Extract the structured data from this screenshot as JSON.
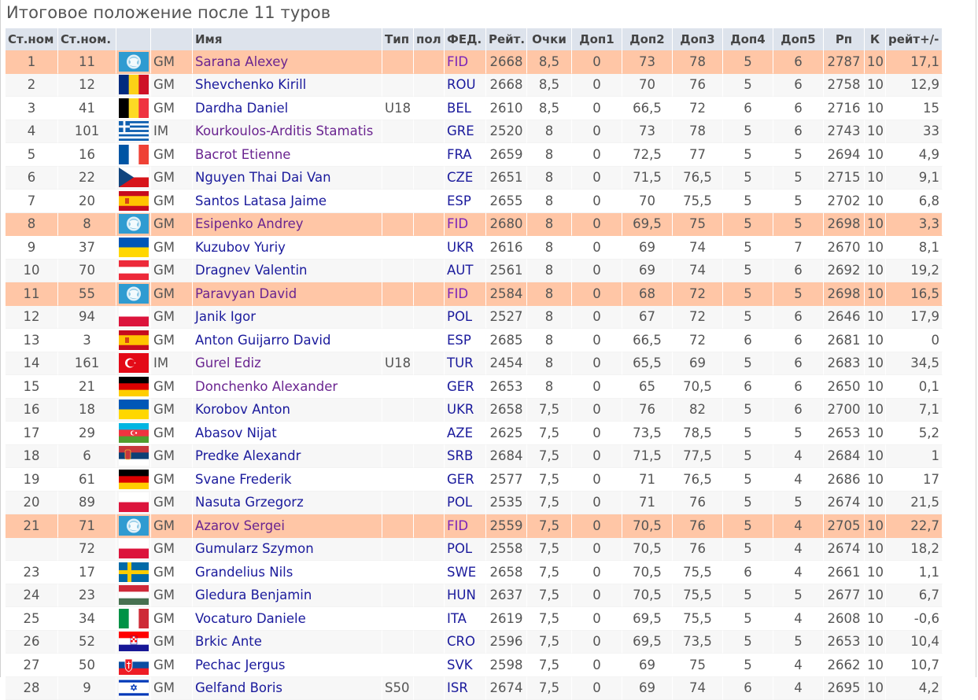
{
  "title": "Итоговое положение после 11 туров",
  "headers": [
    "Ст.ном",
    "Ст.ном.",
    "",
    "",
    "Имя",
    "Тип",
    "пол",
    "ФЕД.",
    "Рейт.",
    "Очки",
    "Доп1",
    "Доп2",
    "Доп3",
    "Доп4",
    "Доп5",
    "Рп",
    "К",
    "рейт+/-"
  ],
  "rows": [
    {
      "rank": "1",
      "sno": "11",
      "flag": "fid-flag",
      "title": "GM",
      "name": "Sarana Alexey",
      "type": "",
      "sex": "",
      "fed": "FID",
      "rtg": "2668",
      "pts": "8,5",
      "tb1": "0",
      "tb2": "73",
      "tb3": "78",
      "tb4": "5",
      "tb5": "6",
      "rp": "2787",
      "k": "10",
      "rc": "17,1",
      "hl": true,
      "visited": true
    },
    {
      "rank": "2",
      "sno": "12",
      "flag": "rou-flag",
      "title": "GM",
      "name": "Shevchenko Kirill",
      "type": "",
      "sex": "",
      "fed": "ROU",
      "rtg": "2668",
      "pts": "8,5",
      "tb1": "0",
      "tb2": "70",
      "tb3": "76",
      "tb4": "5",
      "tb5": "6",
      "rp": "2758",
      "k": "10",
      "rc": "12,9",
      "hl": false,
      "visited": false
    },
    {
      "rank": "3",
      "sno": "41",
      "flag": "bel-flag",
      "title": "GM",
      "name": "Dardha Daniel",
      "type": "U18",
      "sex": "",
      "fed": "BEL",
      "rtg": "2610",
      "pts": "8,5",
      "tb1": "0",
      "tb2": "66,5",
      "tb3": "72",
      "tb4": "6",
      "tb5": "6",
      "rp": "2716",
      "k": "10",
      "rc": "15",
      "hl": false,
      "visited": false
    },
    {
      "rank": "4",
      "sno": "101",
      "flag": "gre-flag",
      "title": "IM",
      "name": "Kourkoulos-Arditis Stamatis",
      "type": "",
      "sex": "",
      "fed": "GRE",
      "rtg": "2520",
      "pts": "8",
      "tb1": "0",
      "tb2": "73",
      "tb3": "78",
      "tb4": "5",
      "tb5": "6",
      "rp": "2743",
      "k": "10",
      "rc": "33",
      "hl": false,
      "visited": true
    },
    {
      "rank": "5",
      "sno": "16",
      "flag": "fra-flag",
      "title": "GM",
      "name": "Bacrot Etienne",
      "type": "",
      "sex": "",
      "fed": "FRA",
      "rtg": "2659",
      "pts": "8",
      "tb1": "0",
      "tb2": "72,5",
      "tb3": "77",
      "tb4": "5",
      "tb5": "5",
      "rp": "2694",
      "k": "10",
      "rc": "4,9",
      "hl": false,
      "visited": true
    },
    {
      "rank": "6",
      "sno": "22",
      "flag": "cze-flag",
      "title": "GM",
      "name": "Nguyen Thai Dai Van",
      "type": "",
      "sex": "",
      "fed": "CZE",
      "rtg": "2651",
      "pts": "8",
      "tb1": "0",
      "tb2": "71,5",
      "tb3": "76,5",
      "tb4": "5",
      "tb5": "5",
      "rp": "2715",
      "k": "10",
      "rc": "9,1",
      "hl": false,
      "visited": false
    },
    {
      "rank": "7",
      "sno": "20",
      "flag": "esp-flag",
      "title": "GM",
      "name": "Santos Latasa Jaime",
      "type": "",
      "sex": "",
      "fed": "ESP",
      "rtg": "2655",
      "pts": "8",
      "tb1": "0",
      "tb2": "70",
      "tb3": "75,5",
      "tb4": "5",
      "tb5": "5",
      "rp": "2702",
      "k": "10",
      "rc": "6,8",
      "hl": false,
      "visited": false
    },
    {
      "rank": "8",
      "sno": "8",
      "flag": "fid-flag",
      "title": "GM",
      "name": "Esipenko Andrey",
      "type": "",
      "sex": "",
      "fed": "FID",
      "rtg": "2680",
      "pts": "8",
      "tb1": "0",
      "tb2": "69,5",
      "tb3": "75",
      "tb4": "5",
      "tb5": "5",
      "rp": "2698",
      "k": "10",
      "rc": "3,3",
      "hl": true,
      "visited": true
    },
    {
      "rank": "9",
      "sno": "37",
      "flag": "ukr-flag",
      "title": "GM",
      "name": "Kuzubov Yuriy",
      "type": "",
      "sex": "",
      "fed": "UKR",
      "rtg": "2616",
      "pts": "8",
      "tb1": "0",
      "tb2": "69",
      "tb3": "74",
      "tb4": "5",
      "tb5": "7",
      "rp": "2670",
      "k": "10",
      "rc": "8,1",
      "hl": false,
      "visited": false
    },
    {
      "rank": "10",
      "sno": "70",
      "flag": "aut-flag",
      "title": "GM",
      "name": "Dragnev Valentin",
      "type": "",
      "sex": "",
      "fed": "AUT",
      "rtg": "2561",
      "pts": "8",
      "tb1": "0",
      "tb2": "69",
      "tb3": "74",
      "tb4": "5",
      "tb5": "6",
      "rp": "2692",
      "k": "10",
      "rc": "19,2",
      "hl": false,
      "visited": false
    },
    {
      "rank": "11",
      "sno": "55",
      "flag": "fid-flag",
      "title": "GM",
      "name": "Paravyan David",
      "type": "",
      "sex": "",
      "fed": "FID",
      "rtg": "2584",
      "pts": "8",
      "tb1": "0",
      "tb2": "68",
      "tb3": "72",
      "tb4": "5",
      "tb5": "5",
      "rp": "2698",
      "k": "10",
      "rc": "16,5",
      "hl": true,
      "visited": true
    },
    {
      "rank": "12",
      "sno": "94",
      "flag": "pol-flag",
      "title": "GM",
      "name": "Janik Igor",
      "type": "",
      "sex": "",
      "fed": "POL",
      "rtg": "2527",
      "pts": "8",
      "tb1": "0",
      "tb2": "67",
      "tb3": "72",
      "tb4": "5",
      "tb5": "6",
      "rp": "2646",
      "k": "10",
      "rc": "17,9",
      "hl": false,
      "visited": false
    },
    {
      "rank": "13",
      "sno": "3",
      "flag": "esp-flag",
      "title": "GM",
      "name": "Anton Guijarro David",
      "type": "",
      "sex": "",
      "fed": "ESP",
      "rtg": "2685",
      "pts": "8",
      "tb1": "0",
      "tb2": "66,5",
      "tb3": "72",
      "tb4": "6",
      "tb5": "6",
      "rp": "2681",
      "k": "10",
      "rc": "0",
      "hl": false,
      "visited": false
    },
    {
      "rank": "14",
      "sno": "161",
      "flag": "tur-flag",
      "title": "IM",
      "name": "Gurel Ediz",
      "type": "U18",
      "sex": "",
      "fed": "TUR",
      "rtg": "2454",
      "pts": "8",
      "tb1": "0",
      "tb2": "65,5",
      "tb3": "69",
      "tb4": "5",
      "tb5": "6",
      "rp": "2683",
      "k": "10",
      "rc": "34,5",
      "hl": false,
      "visited": true
    },
    {
      "rank": "15",
      "sno": "21",
      "flag": "ger-flag",
      "title": "GM",
      "name": "Donchenko Alexander",
      "type": "",
      "sex": "",
      "fed": "GER",
      "rtg": "2653",
      "pts": "8",
      "tb1": "0",
      "tb2": "65",
      "tb3": "70,5",
      "tb4": "6",
      "tb5": "6",
      "rp": "2650",
      "k": "10",
      "rc": "0,1",
      "hl": false,
      "visited": true
    },
    {
      "rank": "16",
      "sno": "18",
      "flag": "ukr-flag",
      "title": "GM",
      "name": "Korobov Anton",
      "type": "",
      "sex": "",
      "fed": "UKR",
      "rtg": "2658",
      "pts": "7,5",
      "tb1": "0",
      "tb2": "76",
      "tb3": "82",
      "tb4": "5",
      "tb5": "6",
      "rp": "2700",
      "k": "10",
      "rc": "7,1",
      "hl": false,
      "visited": false
    },
    {
      "rank": "17",
      "sno": "29",
      "flag": "aze-flag",
      "title": "GM",
      "name": "Abasov Nijat",
      "type": "",
      "sex": "",
      "fed": "AZE",
      "rtg": "2625",
      "pts": "7,5",
      "tb1": "0",
      "tb2": "73,5",
      "tb3": "78,5",
      "tb4": "5",
      "tb5": "5",
      "rp": "2653",
      "k": "10",
      "rc": "5,2",
      "hl": false,
      "visited": false
    },
    {
      "rank": "18",
      "sno": "6",
      "flag": "srb-flag",
      "title": "GM",
      "name": "Predke Alexandr",
      "type": "",
      "sex": "",
      "fed": "SRB",
      "rtg": "2684",
      "pts": "7,5",
      "tb1": "0",
      "tb2": "71,5",
      "tb3": "77,5",
      "tb4": "5",
      "tb5": "4",
      "rp": "2684",
      "k": "10",
      "rc": "1",
      "hl": false,
      "visited": false
    },
    {
      "rank": "19",
      "sno": "61",
      "flag": "ger-flag",
      "title": "GM",
      "name": "Svane Frederik",
      "type": "",
      "sex": "",
      "fed": "GER",
      "rtg": "2577",
      "pts": "7,5",
      "tb1": "0",
      "tb2": "71",
      "tb3": "76,5",
      "tb4": "5",
      "tb5": "4",
      "rp": "2686",
      "k": "10",
      "rc": "17",
      "hl": false,
      "visited": false
    },
    {
      "rank": "20",
      "sno": "89",
      "flag": "pol-flag",
      "title": "GM",
      "name": "Nasuta Grzegorz",
      "type": "",
      "sex": "",
      "fed": "POL",
      "rtg": "2535",
      "pts": "7,5",
      "tb1": "0",
      "tb2": "71",
      "tb3": "76",
      "tb4": "5",
      "tb5": "5",
      "rp": "2674",
      "k": "10",
      "rc": "21,5",
      "hl": false,
      "visited": false
    },
    {
      "rank": "21",
      "sno": "71",
      "flag": "fid-flag",
      "title": "GM",
      "name": "Azarov Sergei",
      "type": "",
      "sex": "",
      "fed": "FID",
      "rtg": "2559",
      "pts": "7,5",
      "tb1": "0",
      "tb2": "70,5",
      "tb3": "76",
      "tb4": "5",
      "tb5": "4",
      "rp": "2705",
      "k": "10",
      "rc": "22,7",
      "hl": true,
      "visited": true
    },
    {
      "rank": "",
      "sno": "72",
      "flag": "pol-flag",
      "title": "GM",
      "name": "Gumularz Szymon",
      "type": "",
      "sex": "",
      "fed": "POL",
      "rtg": "2558",
      "pts": "7,5",
      "tb1": "0",
      "tb2": "70,5",
      "tb3": "76",
      "tb4": "5",
      "tb5": "4",
      "rp": "2674",
      "k": "10",
      "rc": "18,2",
      "hl": false,
      "visited": false
    },
    {
      "rank": "23",
      "sno": "17",
      "flag": "swe-flag",
      "title": "GM",
      "name": "Grandelius Nils",
      "type": "",
      "sex": "",
      "fed": "SWE",
      "rtg": "2658",
      "pts": "7,5",
      "tb1": "0",
      "tb2": "70,5",
      "tb3": "75,5",
      "tb4": "6",
      "tb5": "4",
      "rp": "2661",
      "k": "10",
      "rc": "1,1",
      "hl": false,
      "visited": false
    },
    {
      "rank": "24",
      "sno": "23",
      "flag": "hun-flag",
      "title": "GM",
      "name": "Gledura Benjamin",
      "type": "",
      "sex": "",
      "fed": "HUN",
      "rtg": "2637",
      "pts": "7,5",
      "tb1": "0",
      "tb2": "70,5",
      "tb3": "75,5",
      "tb4": "5",
      "tb5": "5",
      "rp": "2677",
      "k": "10",
      "rc": "6,7",
      "hl": false,
      "visited": false
    },
    {
      "rank": "25",
      "sno": "34",
      "flag": "ita-flag",
      "title": "GM",
      "name": "Vocaturo Daniele",
      "type": "",
      "sex": "",
      "fed": "ITA",
      "rtg": "2619",
      "pts": "7,5",
      "tb1": "0",
      "tb2": "69,5",
      "tb3": "75,5",
      "tb4": "5",
      "tb5": "4",
      "rp": "2608",
      "k": "10",
      "rc": "-0,6",
      "hl": false,
      "visited": false
    },
    {
      "rank": "26",
      "sno": "52",
      "flag": "cro-flag",
      "title": "GM",
      "name": "Brkic Ante",
      "type": "",
      "sex": "",
      "fed": "CRO",
      "rtg": "2596",
      "pts": "7,5",
      "tb1": "0",
      "tb2": "69,5",
      "tb3": "73,5",
      "tb4": "5",
      "tb5": "5",
      "rp": "2653",
      "k": "10",
      "rc": "10,4",
      "hl": false,
      "visited": false
    },
    {
      "rank": "27",
      "sno": "50",
      "flag": "svk-flag",
      "title": "GM",
      "name": "Pechac Jergus",
      "type": "",
      "sex": "",
      "fed": "SVK",
      "rtg": "2598",
      "pts": "7,5",
      "tb1": "0",
      "tb2": "69",
      "tb3": "75",
      "tb4": "5",
      "tb5": "4",
      "rp": "2662",
      "k": "10",
      "rc": "10,7",
      "hl": false,
      "visited": false
    },
    {
      "rank": "28",
      "sno": "9",
      "flag": "isr-flag",
      "title": "GM",
      "name": "Gelfand Boris",
      "type": "S50",
      "sex": "",
      "fed": "ISR",
      "rtg": "2674",
      "pts": "7,5",
      "tb1": "0",
      "tb2": "69",
      "tb3": "74",
      "tb4": "6",
      "tb5": "4",
      "rp": "2695",
      "k": "10",
      "rc": "4,2",
      "hl": false,
      "visited": false
    }
  ],
  "colors": {
    "header_bg": "#dde3ec",
    "highlight_row": "#ffc6a6",
    "link": "#1a1a9c",
    "visited_link": "#6a2490"
  }
}
